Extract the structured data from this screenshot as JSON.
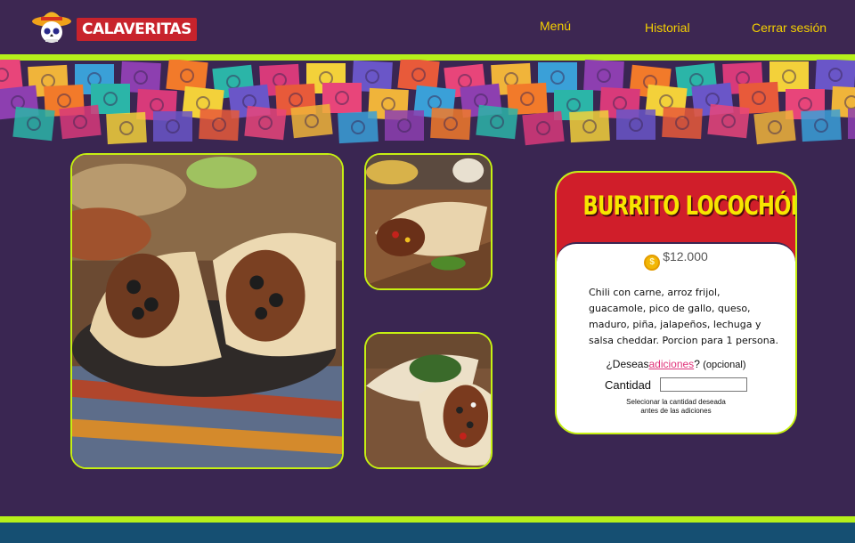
{
  "brand": {
    "name": "CALAVERITAS"
  },
  "nav": {
    "items": [
      "Menú",
      "Historial",
      "Cerrar sesión"
    ]
  },
  "colors": {
    "accent_green": "#b6f01a",
    "header_bg": "#3d2752",
    "title_red": "#d01e2a",
    "title_yellow": "#f7e600",
    "link_pink": "#e0337a",
    "nav_yellow": "#f5d000"
  },
  "product": {
    "title": "BURRITO LOCOCHÓN",
    "price": "$12.000",
    "price_icon": "coin-icon",
    "description": "Chili con carne, arroz frijol, guacamole, pico de gallo, queso, maduro, piña, jalapeños, lechuga y salsa cheddar. Porcion para 1 persona.",
    "addons_prefix": "¿Deseas",
    "addons_link": "adiciones",
    "addons_suffix": "?",
    "addons_optional": "(opcional)",
    "quantity_label": "Cantidad",
    "quantity_value": "",
    "note_line1": "Selecionar la cantidad deseada",
    "note_line2": "antes de las adiciones"
  }
}
